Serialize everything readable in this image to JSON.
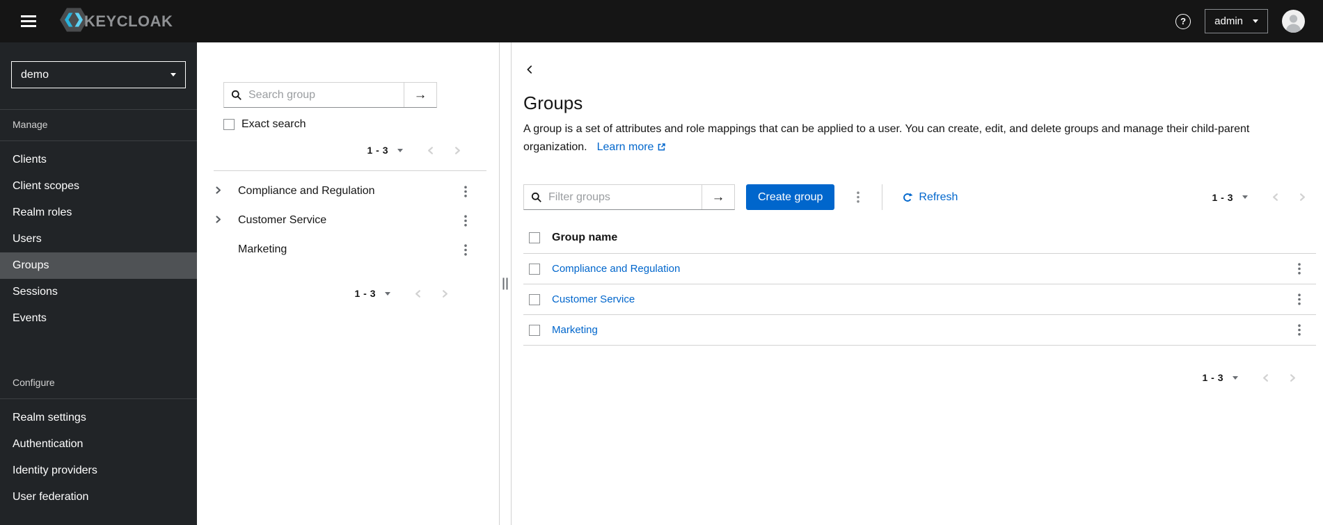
{
  "masthead": {
    "brand": "KEYCLOAK",
    "username": "admin"
  },
  "sidebar": {
    "realm": "demo",
    "manage_label": "Manage",
    "manage_items": [
      "Clients",
      "Client scopes",
      "Realm roles",
      "Users",
      "Groups",
      "Sessions",
      "Events"
    ],
    "configure_label": "Configure",
    "configure_items": [
      "Realm settings",
      "Authentication",
      "Identity providers",
      "User federation"
    ],
    "active_item": "Groups"
  },
  "tree_panel": {
    "search_placeholder": "Search group",
    "exact_search_label": "Exact search",
    "pagination_top": "1 - 3",
    "pagination_bottom": "1 - 3",
    "items": [
      {
        "name": "Compliance and Regulation",
        "expandable": true
      },
      {
        "name": "Customer Service",
        "expandable": true
      },
      {
        "name": "Marketing",
        "expandable": false
      }
    ]
  },
  "main": {
    "title": "Groups",
    "description": "A group is a set of attributes and role mappings that can be applied to a user. You can create, edit, and delete groups and manage their child-parent organization.",
    "learn_more": "Learn more",
    "toolbar": {
      "filter_placeholder": "Filter groups",
      "create_button": "Create group",
      "refresh": "Refresh",
      "pagination": "1 - 3"
    },
    "table": {
      "header": "Group name",
      "rows": [
        {
          "name": "Compliance and Regulation"
        },
        {
          "name": "Customer Service"
        },
        {
          "name": "Marketing"
        }
      ]
    },
    "pagination_bottom": "1 - 3"
  },
  "colors": {
    "masthead_bg": "#151515",
    "sidebar_bg": "#212427",
    "active_nav_bg": "#4f5255",
    "link": "#0066cc",
    "primary_button": "#0066cc"
  }
}
